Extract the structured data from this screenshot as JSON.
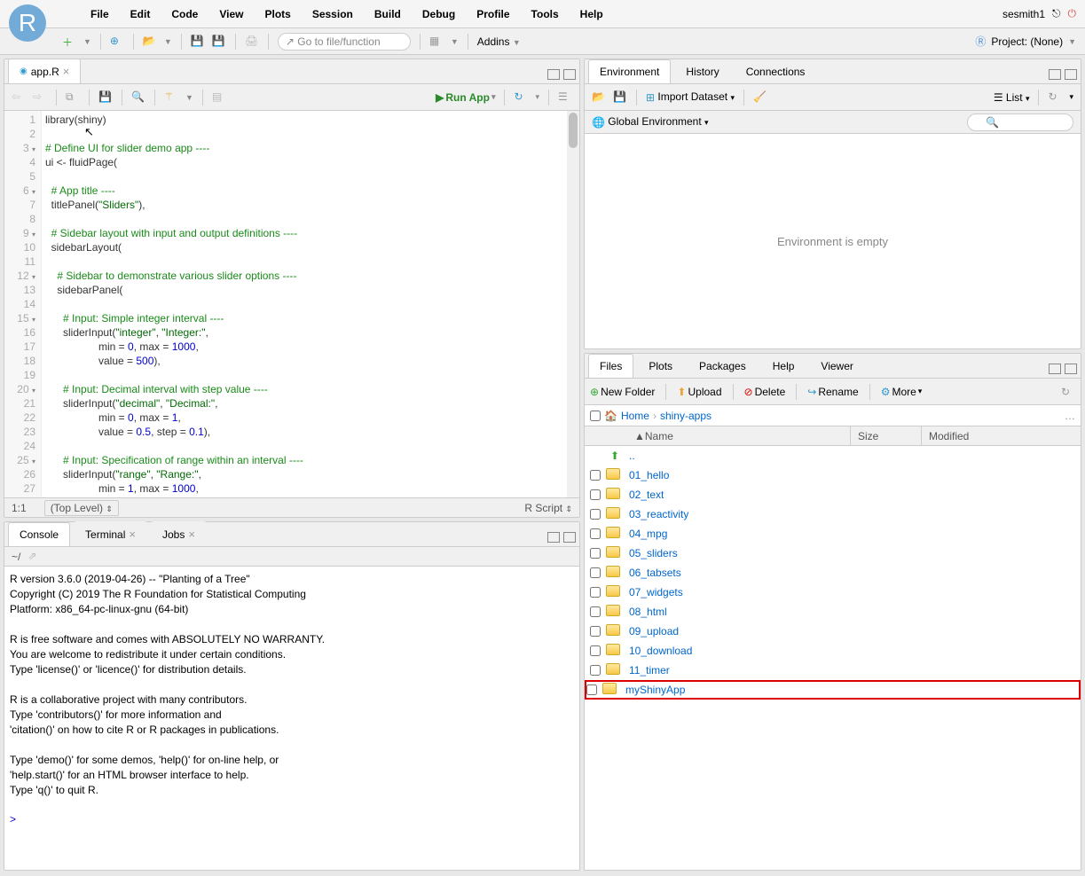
{
  "menu": {
    "items": [
      "File",
      "Edit",
      "Code",
      "View",
      "Plots",
      "Session",
      "Build",
      "Debug",
      "Profile",
      "Tools",
      "Help"
    ],
    "user": "sesmith1",
    "project": "Project: (None)"
  },
  "toolbar": {
    "goto": "Go to file/function",
    "addins": "Addins"
  },
  "source": {
    "tab": "app.R",
    "runapp": "Run App",
    "lines": [
      {
        "n": "1",
        "h": "<span class='f'>library</span>(shiny)"
      },
      {
        "n": "2",
        "h": ""
      },
      {
        "n": "3",
        "f": "▾",
        "h": "<span class='c'># Define UI for slider demo app ----</span>"
      },
      {
        "n": "4",
        "h": "ui &lt;- fluidPage("
      },
      {
        "n": "5",
        "h": ""
      },
      {
        "n": "6",
        "f": "▾",
        "h": "  <span class='c'># App title ----</span>"
      },
      {
        "n": "7",
        "h": "  titlePanel(<span class='s'>\"Sliders\"</span>),"
      },
      {
        "n": "8",
        "h": ""
      },
      {
        "n": "9",
        "f": "▾",
        "h": "  <span class='c'># Sidebar layout with input and output definitions ----</span>"
      },
      {
        "n": "10",
        "h": "  sidebarLayout("
      },
      {
        "n": "11",
        "h": ""
      },
      {
        "n": "12",
        "f": "▾",
        "h": "    <span class='c'># Sidebar to demonstrate various slider options ----</span>"
      },
      {
        "n": "13",
        "h": "    sidebarPanel("
      },
      {
        "n": "14",
        "h": ""
      },
      {
        "n": "15",
        "f": "▾",
        "h": "      <span class='c'># Input: Simple integer interval ----</span>"
      },
      {
        "n": "16",
        "h": "      sliderInput(<span class='s'>\"integer\"</span>, <span class='s'>\"Integer:\"</span>,"
      },
      {
        "n": "17",
        "h": "                  min = <span class='n'>0</span>, max = <span class='n'>1000</span>,"
      },
      {
        "n": "18",
        "h": "                  value = <span class='n'>500</span>),"
      },
      {
        "n": "19",
        "h": ""
      },
      {
        "n": "20",
        "f": "▾",
        "h": "      <span class='c'># Input: Decimal interval with step value ----</span>"
      },
      {
        "n": "21",
        "h": "      sliderInput(<span class='s'>\"decimal\"</span>, <span class='s'>\"Decimal:\"</span>,"
      },
      {
        "n": "22",
        "h": "                  min = <span class='n'>0</span>, max = <span class='n'>1</span>,"
      },
      {
        "n": "23",
        "h": "                  value = <span class='n'>0.5</span>, step = <span class='n'>0.1</span>),"
      },
      {
        "n": "24",
        "h": ""
      },
      {
        "n": "25",
        "f": "▾",
        "h": "      <span class='c'># Input: Specification of range within an interval ----</span>"
      },
      {
        "n": "26",
        "h": "      sliderInput(<span class='s'>\"range\"</span>, <span class='s'>\"Range:\"</span>,"
      },
      {
        "n": "27",
        "h": "                  min = <span class='n'>1</span>, max = <span class='n'>1000</span>,"
      }
    ],
    "status_pos": "1:1",
    "status_scope": "(Top Level)",
    "status_lang": "R Script"
  },
  "console": {
    "tabs": [
      "Console",
      "Terminal",
      "Jobs"
    ],
    "prompt": "~/",
    "text": "R version 3.6.0 (2019-04-26) -- \"Planting of a Tree\"\nCopyright (C) 2019 The R Foundation for Statistical Computing\nPlatform: x86_64-pc-linux-gnu (64-bit)\n\nR is free software and comes with ABSOLUTELY NO WARRANTY.\nYou are welcome to redistribute it under certain conditions.\nType 'license()' or 'licence()' for distribution details.\n\nR is a collaborative project with many contributors.\nType 'contributors()' for more information and\n'citation()' on how to cite R or R packages in publications.\n\nType 'demo()' for some demos, 'help()' for on-line help, or\n'help.start()' for an HTML browser interface to help.\nType 'q()' to quit R.\n",
    "input_prompt": ">"
  },
  "env": {
    "tabs": [
      "Environment",
      "History",
      "Connections"
    ],
    "import": "Import Dataset",
    "scope": "Global Environment",
    "view": "List",
    "empty": "Environment is empty"
  },
  "files": {
    "tabs": [
      "Files",
      "Plots",
      "Packages",
      "Help",
      "Viewer"
    ],
    "actions": {
      "newfolder": "New Folder",
      "upload": "Upload",
      "delete": "Delete",
      "rename": "Rename",
      "more": "More"
    },
    "crumbs": [
      "Home",
      "shiny-apps"
    ],
    "headers": {
      "name": "Name",
      "size": "Size",
      "modified": "Modified"
    },
    "up": "..",
    "items": [
      "01_hello",
      "02_text",
      "03_reactivity",
      "04_mpg",
      "05_sliders",
      "06_tabsets",
      "07_widgets",
      "08_html",
      "09_upload",
      "10_download",
      "11_timer",
      "myShinyApp"
    ]
  }
}
